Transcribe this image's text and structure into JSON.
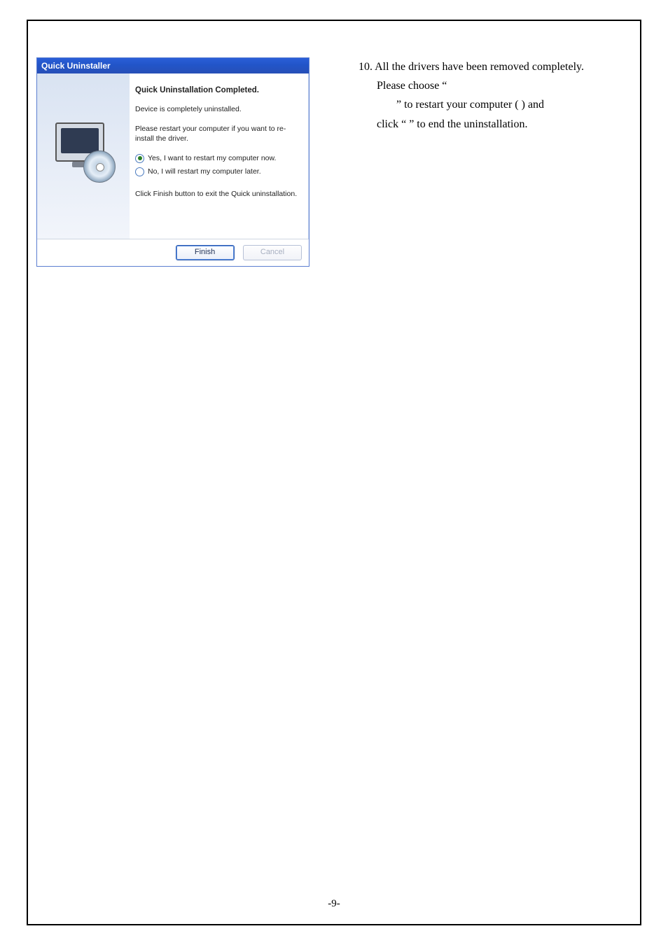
{
  "dialog": {
    "title": "Quick Uninstaller",
    "heading": "Quick Uninstallation Completed.",
    "line1": "Device is completely uninstalled.",
    "line2": "Please restart your computer if you want to re-install the driver.",
    "radio_yes": "Yes, I want to restart my computer now.",
    "radio_no": "No, I will restart my computer later.",
    "line3": "Click Finish button to exit the Quick uninstallation.",
    "finish_label": "Finish",
    "cancel_label": "Cancel"
  },
  "instructions": {
    "step_number": "10.",
    "t1": "All the drivers have been removed completely.",
    "t2a": "Please choose “",
    "t2b": "” to restart your computer (",
    "t2c": ") and",
    "t3a": "click “",
    "t3b": "” to end the uninstallation."
  },
  "page_number": "-9-"
}
